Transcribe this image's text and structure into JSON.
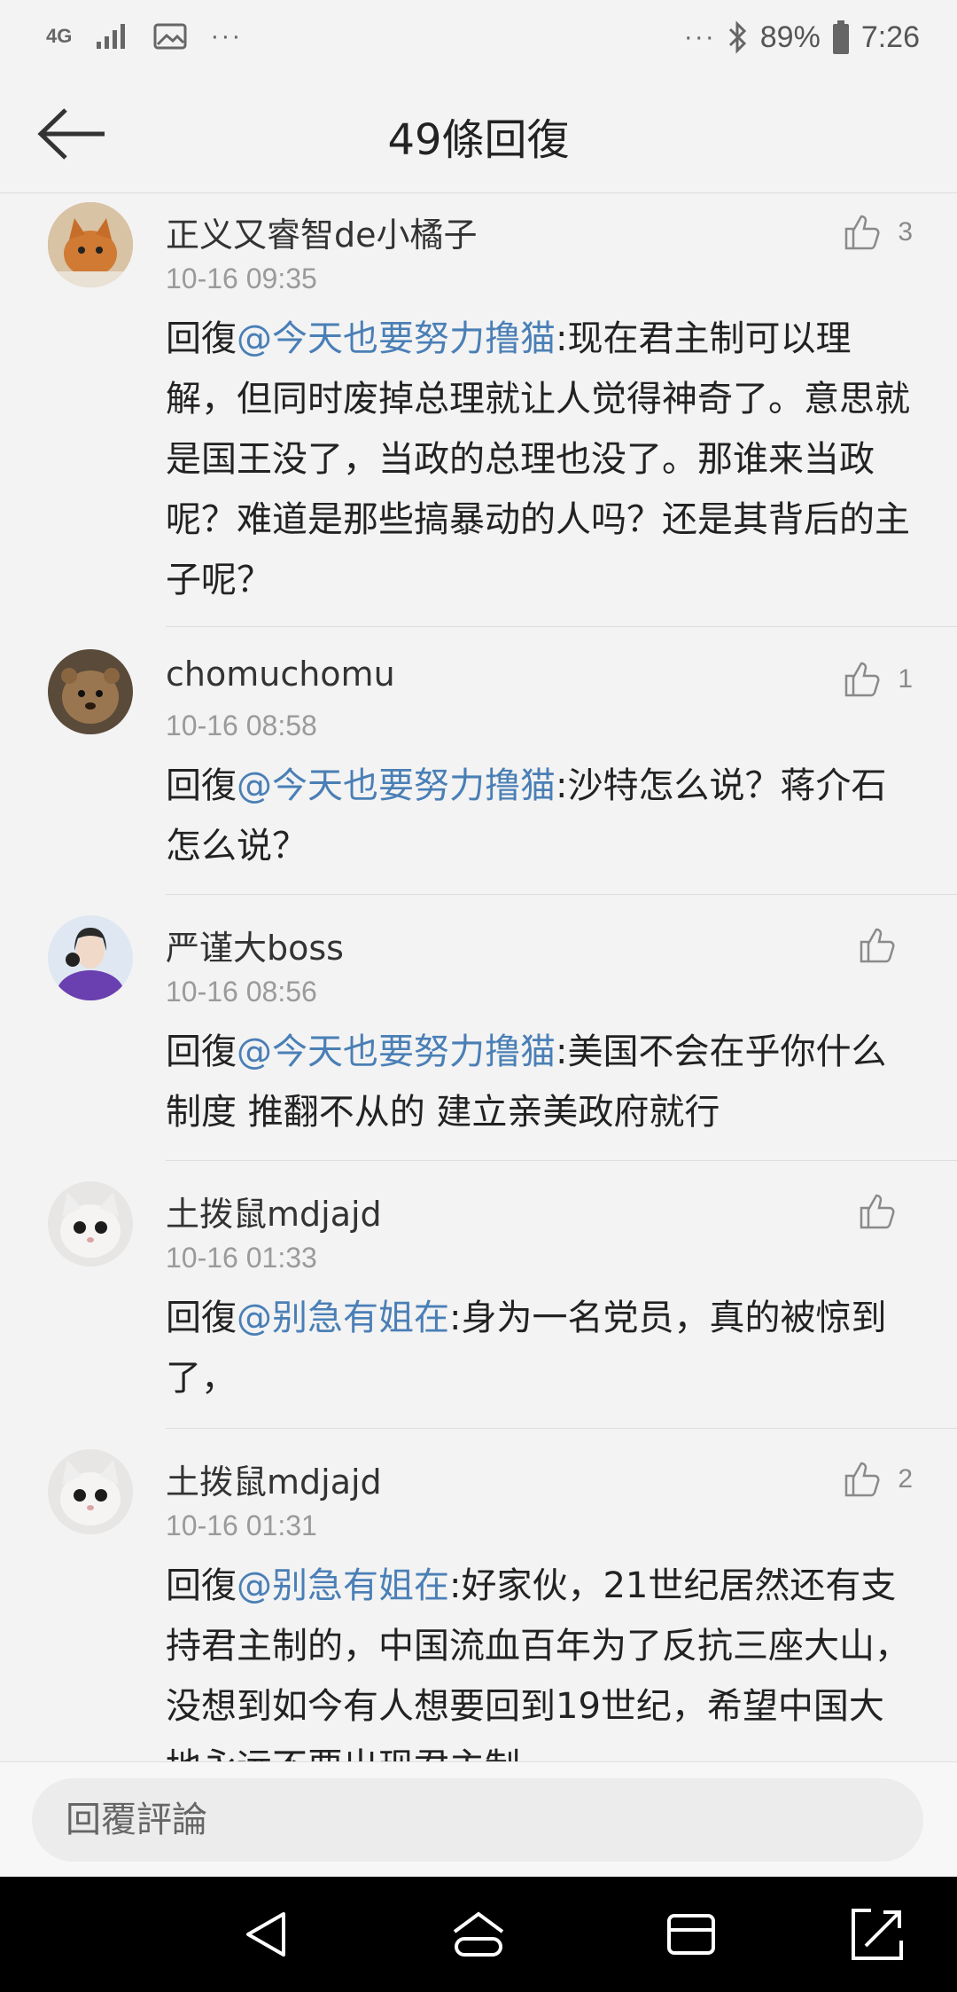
{
  "status_bar": {
    "network": "4G",
    "dots_left": "···",
    "dots_right": "···",
    "battery": "89%",
    "time": "7:26"
  },
  "header": {
    "title": "49條回復",
    "back_icon": "arrow-left-icon"
  },
  "comments": [
    {
      "username": "正义又睿智de小橘子",
      "date": "10-16 09:35",
      "likes": "3",
      "reply_prefix": "回復",
      "mention": "@今天也要努力撸猫",
      "text": ":现在君主制可以理解，但同时废掉总理就让人觉得神奇了。意思就是国王没了，当政的总理也没了。那谁来当政呢？难道是那些搞暴动的人吗？还是其背后的主子呢？",
      "avatar": "orange-cat-avatar"
    },
    {
      "username": "chomuchomu",
      "date": "10-16 08:58",
      "likes": "1",
      "reply_prefix": "回復",
      "mention": "@今天也要努力撸猫",
      "text": ":沙特怎么说？蒋介石怎么说？",
      "avatar": "quokka-avatar"
    },
    {
      "username": "严谨大boss",
      "date": "10-16 08:56",
      "likes": "",
      "reply_prefix": "回復",
      "mention": "@今天也要努力撸猫",
      "text": ":美国不会在乎你什么制度 推翻不从的 建立亲美政府就行",
      "avatar": "girl-purple-avatar"
    },
    {
      "username": "土拨鼠mdjajd",
      "date": "10-16 01:33",
      "likes": "",
      "reply_prefix": "回復",
      "mention": "@别急有姐在",
      "text": ":身为一名党员，真的被惊到了，",
      "avatar": "white-cat-avatar"
    },
    {
      "username": "土拨鼠mdjajd",
      "date": "10-16 01:31",
      "likes": "2",
      "reply_prefix": "回復",
      "mention": "@别急有姐在",
      "text": ":好家伙，21世纪居然还有支持君主制的，中国流血百年为了反抗三座大山，没想到如今有人想要回到19世纪，希望中国大地永远不要出现君主制",
      "avatar": "white-cat-avatar"
    }
  ],
  "reply_bar": {
    "placeholder": "回覆評論"
  },
  "colors": {
    "mention": "#4a7fb6",
    "background": "#f3f3f3",
    "date": "#9a9a9a"
  }
}
